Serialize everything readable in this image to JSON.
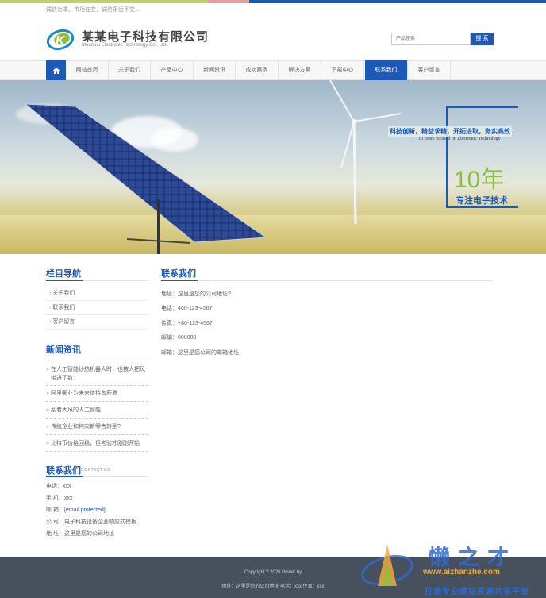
{
  "top": {
    "slogan": "诚信为本，市场在变，诚信永远不变..."
  },
  "header": {
    "company": "某某电子科技有限公司",
    "company_en": "Moumou Electronic Technology Co., Ltd.",
    "search_placeholder": "产品搜索",
    "search_button": "搜 索"
  },
  "nav": {
    "items": [
      "网站首页",
      "关于我们",
      "产品中心",
      "新闻资讯",
      "成功案例",
      "解决方案",
      "下载中心",
      "联系我们",
      "客户留言"
    ],
    "active": "联系我们"
  },
  "banner": {
    "line1": "科技创新，精益求精，开拓进取，务实高效",
    "line2": "10 years focused on Electronic Technology",
    "big": "10年",
    "line3": "专注电子技术"
  },
  "sidebar": {
    "title": "栏目导航",
    "items": [
      "关于我们",
      "联系我们",
      "客户留言"
    ],
    "news_title": "新闻资讯",
    "news": [
      "在人工智能炒热机器人时，也被人把风带进了数",
      "阿里郵业为未来增持淘鹿质",
      "刮着大风的人工智能",
      "传统企业如何向新零售转型?",
      "比特币价格回稳，但考验才刚刚开始"
    ],
    "contact_title": "联系我们",
    "contact_sub": "CONTACT US",
    "contact": {
      "phone": "电话：xxx",
      "mobile": "手 机：xxx",
      "email_label": "邮 箱：",
      "email": "[email protected]",
      "company": "公 司：电子科技设备企业响应式模板",
      "address": "地 址：这里是您的公司地址"
    }
  },
  "main": {
    "title": "联系我们",
    "rows": [
      "地址：这里是您的公司地址?",
      "电话：400-123-4567",
      "传真：+86-123-4567",
      "邮编：000000",
      "邮箱：这里是您公司的邮箱地址"
    ]
  },
  "footer": {
    "copyright": "Copyright ? 2020 Power by",
    "address": "地址：这里是您的公司地址   电话：xxx   传真：xxx"
  },
  "watermark": {
    "name": "懒之才",
    "url": "www.aizhanzhe.com",
    "slogan": "打造专业建站资源共享平台"
  },
  "colors": {
    "primary": "#1d5ab8",
    "accent_green": "#8cbf3f",
    "footer_bg": "#46515d"
  }
}
